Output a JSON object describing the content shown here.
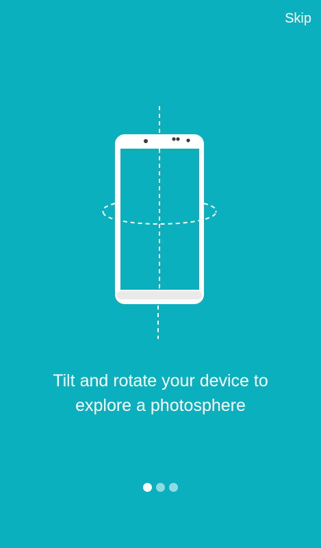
{
  "header": {
    "skip_label": "Skip"
  },
  "illustration": {
    "icon": "phone-rotate-icon"
  },
  "caption": {
    "line1": "Tilt and rotate your device to",
    "line2": "explore a photosphere"
  },
  "pager": {
    "total_pages": 3,
    "current_page": 1
  },
  "colors": {
    "background": "#0bb0bf",
    "foreground": "#ffffff"
  }
}
